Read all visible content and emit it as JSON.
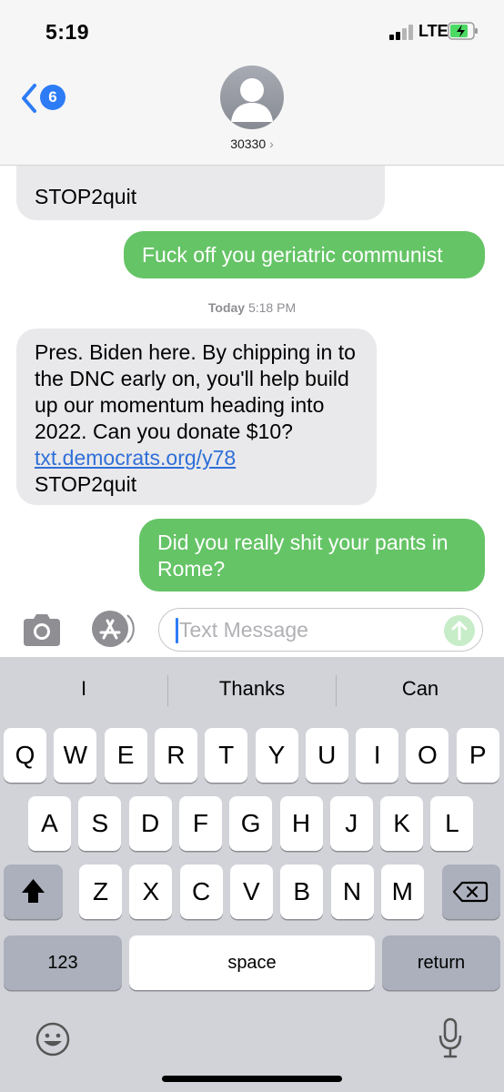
{
  "status": {
    "time": "5:19",
    "network": "LTE"
  },
  "nav": {
    "back_count": "6",
    "contact": "30330",
    "chevron": "›"
  },
  "messages": {
    "partial_in": "STOP2quit",
    "out1": "Fuck off you geriatric communist",
    "timestamp_day": "Today",
    "timestamp_time": "5:18 PM",
    "in_body": "Pres. Biden here. By chipping in to the DNC early on, you'll help build up our momentum heading into 2022. Can you donate $10?",
    "in_link": "txt.democrats.org/y78",
    "in_stop": "STOP2quit",
    "out2": "Did you really shit your pants in Rome?"
  },
  "input": {
    "placeholder": "Text Message"
  },
  "keyboard": {
    "suggestions": [
      "I",
      "Thanks",
      "Can"
    ],
    "row1": [
      "Q",
      "W",
      "E",
      "R",
      "T",
      "Y",
      "U",
      "I",
      "O",
      "P"
    ],
    "row2": [
      "A",
      "S",
      "D",
      "F",
      "G",
      "H",
      "J",
      "K",
      "L"
    ],
    "row3": [
      "Z",
      "X",
      "C",
      "V",
      "B",
      "N",
      "M"
    ],
    "numbers": "123",
    "space": "space",
    "return": "return"
  },
  "icons": {
    "back": "chevron-left-icon",
    "avatar": "person-icon",
    "camera": "camera-icon",
    "appstore": "app-store-icon",
    "send": "arrow-up-icon",
    "shift": "shift-icon",
    "delete": "backspace-icon",
    "emoji": "emoji-icon",
    "mic": "microphone-icon"
  },
  "colors": {
    "outgoing": "#65c466",
    "incoming": "#e9e9eb",
    "accent": "#2d7cf6",
    "keyboard": "#d1d3d9"
  }
}
